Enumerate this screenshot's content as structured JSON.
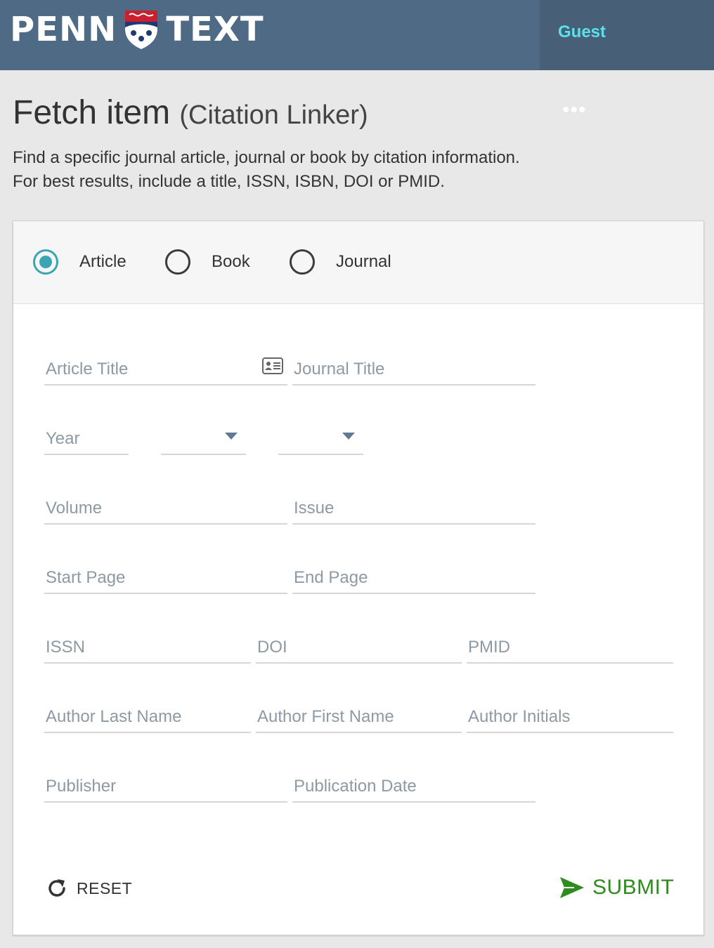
{
  "header": {
    "logo_left": "PENN",
    "logo_right": "TEXT",
    "user_label": "Guest",
    "colors": {
      "bar": "#4f6a85",
      "user": "#5ce1e6"
    }
  },
  "page": {
    "title": "Fetch item",
    "subtitle": "(Citation Linker)",
    "more": "•••",
    "desc_line1": "Find a specific journal article, journal or book by citation information.",
    "desc_line2": "For best results, include a title, ISSN, ISBN, DOI or PMID."
  },
  "type_options": [
    {
      "label": "Article",
      "selected": true
    },
    {
      "label": "Book",
      "selected": false
    },
    {
      "label": "Journal",
      "selected": false
    }
  ],
  "fields": {
    "article_title": "Article Title",
    "journal_title": "Journal Title",
    "year": "Year",
    "volume": "Volume",
    "issue": "Issue",
    "start_page": "Start Page",
    "end_page": "End Page",
    "issn": "ISSN",
    "doi": "DOI",
    "pmid": "PMID",
    "author_last": "Author Last Name",
    "author_first": "Author First Name",
    "author_initials": "Author Initials",
    "publisher": "Publisher",
    "publication_date": "Publication Date"
  },
  "actions": {
    "reset": "RESET",
    "submit": "SUBMIT",
    "submit_color": "#2e8b1e"
  }
}
